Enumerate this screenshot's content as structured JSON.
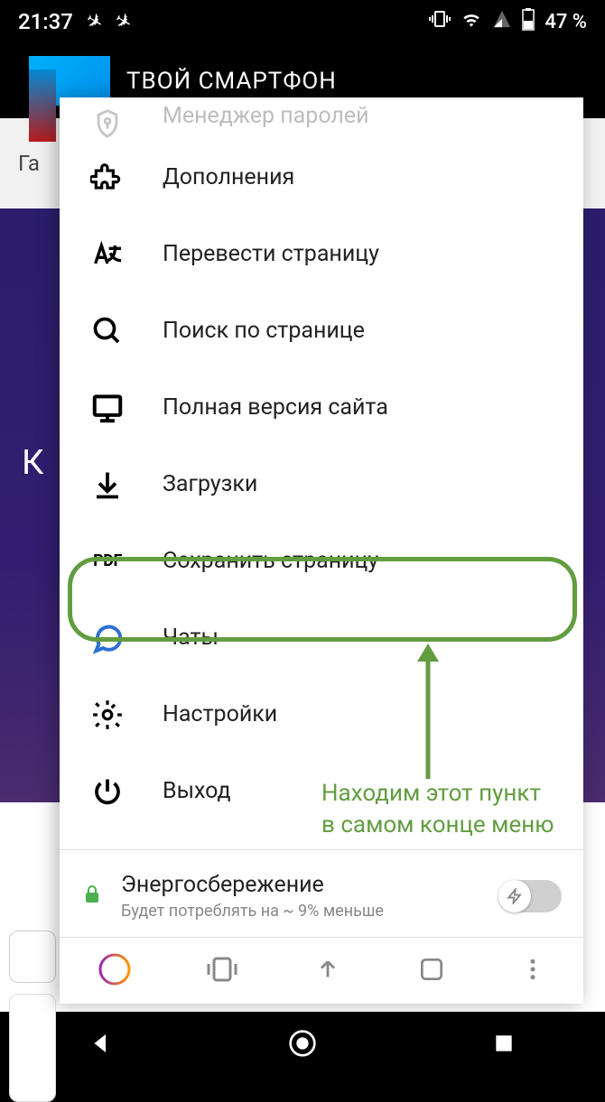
{
  "status": {
    "time": "21:37",
    "battery": "47 %"
  },
  "watermark": {
    "text": "ТВОЙ СМАРТФОН"
  },
  "gray_text": "Га",
  "purple_letter": "К",
  "menu": {
    "password_manager": "Менеджер паролей",
    "addons": "Дополнения",
    "translate": "Перевести страницу",
    "search": "Поиск по странице",
    "desktop": "Полная версия сайта",
    "downloads": "Загрузки",
    "save_page": "Сохранить страницу",
    "chats": "Чаты",
    "settings": "Настройки",
    "exit": "Выход"
  },
  "energy": {
    "title": "Энергосбережение",
    "subtitle": "Будет потреблять на ~ 9% меньше"
  },
  "annotation": {
    "line1": "Находим этот пункт",
    "line2": "в самом конце меню"
  }
}
